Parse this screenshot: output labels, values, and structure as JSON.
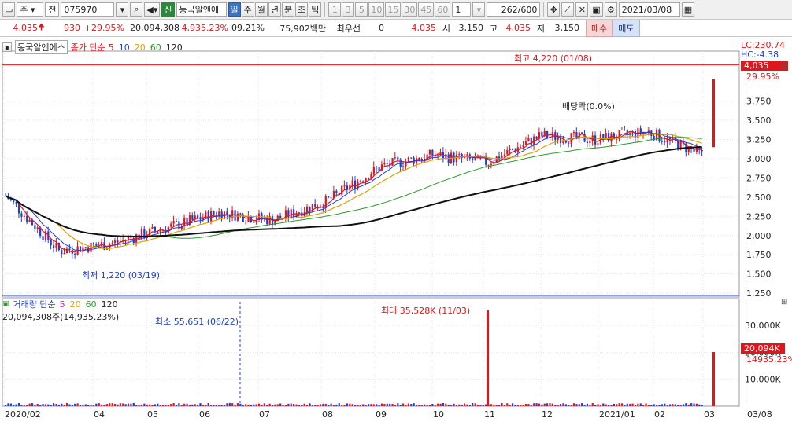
{
  "toolbar": {
    "market": "주",
    "prev_label": "전",
    "code": "075970",
    "badge_new": "신",
    "stock_name": "동국알앤에",
    "periods": [
      "일",
      "주",
      "월",
      "년",
      "분",
      "초",
      "틱"
    ],
    "active_period": "일",
    "counts": [
      "1",
      "3",
      "5",
      "10",
      "15",
      "30",
      "45",
      "60"
    ],
    "spin": "1",
    "range": "262",
    "range_total": "/600",
    "date": "2021/03/08"
  },
  "quote": {
    "price": "4,035",
    "change": "930",
    "change_pct": "+29.95%",
    "volume": "20,094,308",
    "vol_ratio": "4,935.23%",
    "turnover": "09.21%",
    "amount": "75,902백만",
    "best_label": "최우선",
    "best_value": "0",
    "last_price": "4,035",
    "open_label": "시",
    "open": "3,150",
    "high_label": "고",
    "high": "4,035",
    "low_label": "저",
    "low": "3,150",
    "buy_label": "매수",
    "sell_label": "매도"
  },
  "price_legend": {
    "stock": "동국알앤에스",
    "ma_label": "종가 단순",
    "mas": [
      "5",
      "10",
      "20",
      "60",
      "120"
    ],
    "ma_colors": [
      "#e0161d",
      "#1d3fd0",
      "#e0a000",
      "#2a9a2a",
      "#222222"
    ]
  },
  "volume_legend": {
    "label": "거래량 단순",
    "mas": [
      "5",
      "20",
      "60",
      "120"
    ],
    "ma_colors": [
      "#c81ec8",
      "#e0a000",
      "#2a9a2a",
      "#222222"
    ],
    "value": "20,094,308주(14,935.23%)"
  },
  "chart_data": {
    "type": "candlestick",
    "x_ticks": [
      "2020/02",
      "04",
      "05",
      "06",
      "07",
      "08",
      "09",
      "10",
      "11",
      "12",
      "2021/01",
      "02",
      "03",
      "03/08"
    ],
    "y_ticks": [
      "3,750",
      "3,500",
      "3,250",
      "3,000",
      "2,750",
      "2,500",
      "2,250",
      "2,000",
      "1,750",
      "1,500",
      "1,250"
    ],
    "y_range": [
      1200,
      4400
    ],
    "high_note": "최고 4,220 (01/08)",
    "low_note": "최저 1,220 (03/19)",
    "dividend_note": "배당락(0.0%)",
    "lc": "LC:230.74",
    "hc": "HC:-4.38",
    "last_price": "4,035",
    "last_change_pct": "29.95%",
    "volume_ticks": [
      "30,000K",
      "20,000K",
      "10,000K"
    ],
    "volume_max_note": "최대 35,528K (11/03)",
    "volume_min_note": "최소 55,651 (06/22)",
    "last_volume": "20,094K",
    "last_volume_pct": "14935.23%",
    "monthly_close": [
      2520,
      1800,
      1900,
      2100,
      2300,
      2200,
      2450,
      2900,
      3050,
      2950,
      3300,
      3250,
      3350,
      3050,
      4035
    ],
    "ma120_monthly": [
      2520,
      2350,
      2250,
      2200,
      2180,
      2200,
      2220,
      2350,
      2550,
      2700,
      2950,
      3050,
      3150,
      3200,
      3250
    ]
  }
}
